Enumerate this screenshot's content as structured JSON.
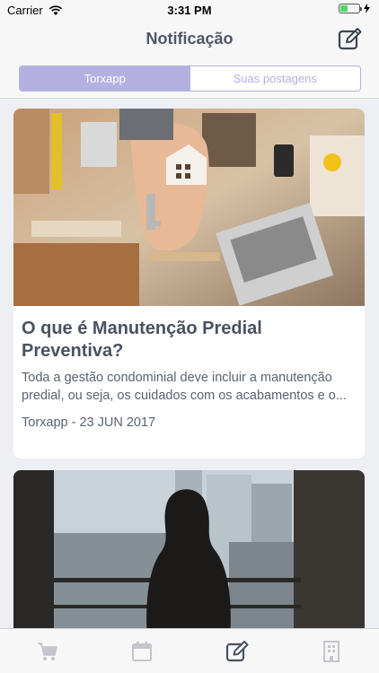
{
  "status_bar": {
    "carrier": "Carrier",
    "time": "3:31 PM"
  },
  "nav": {
    "title": "Notificação",
    "action_icon": "compose-icon"
  },
  "segments": [
    {
      "label": "Torxapp",
      "selected": true
    },
    {
      "label": "Suas postagens",
      "selected": false
    }
  ],
  "posts": [
    {
      "title": "O que é Manutenção Predial Preventiva?",
      "excerpt": "Toda a gestão condominial deve incluir a manutenção predial, ou seja, os cuidados com os acabamentos e o...",
      "author": "Torxapp",
      "date": "23 JUN 2017",
      "meta": "Torxapp - 23 JUN 2017"
    },
    {
      "title": "",
      "excerpt": "",
      "meta": ""
    }
  ],
  "tabbar": {
    "items": [
      {
        "icon": "cart-icon"
      },
      {
        "icon": "calendar-icon"
      },
      {
        "icon": "compose-icon",
        "selected": true
      },
      {
        "icon": "building-icon"
      }
    ]
  },
  "colors": {
    "accent": "#b4b0e2",
    "text": "#4a5260",
    "background": "#eeeff3"
  }
}
